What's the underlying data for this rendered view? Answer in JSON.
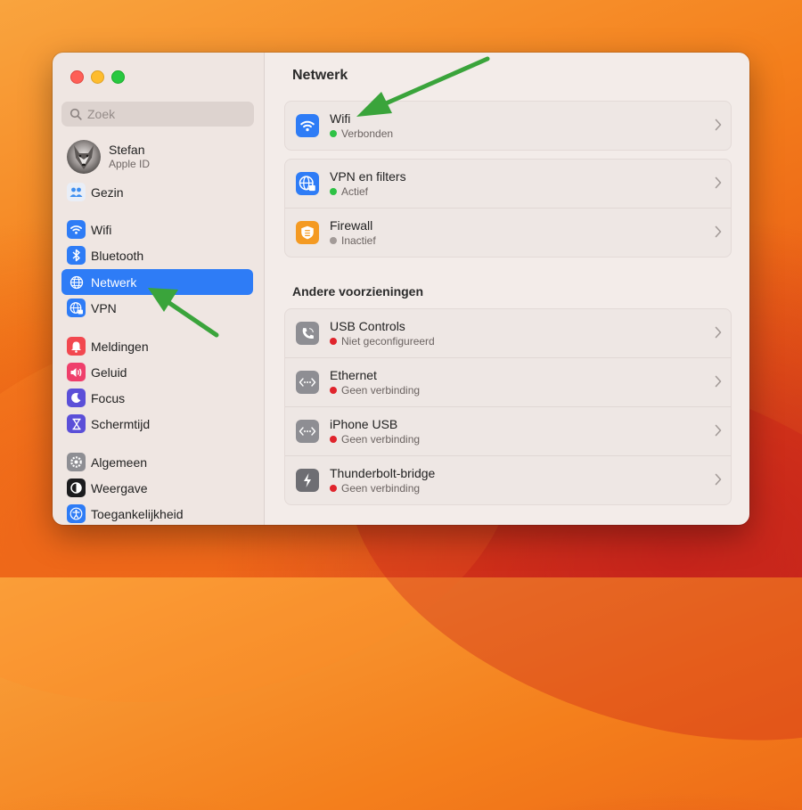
{
  "colors": {
    "accent": "#2e7cf6",
    "status_green": "#2ec245",
    "status_gray": "#a39b98",
    "status_red": "#e0242c",
    "annotation_arrow": "#3aa43b"
  },
  "sidebar": {
    "search": {
      "placeholder": "Zoek"
    },
    "profile": {
      "name": "Stefan",
      "subtitle": "Apple ID"
    },
    "items": [
      {
        "label": "Gezin",
        "icon": "family-icon"
      },
      {
        "label": "Wifi",
        "icon": "wifi-icon"
      },
      {
        "label": "Bluetooth",
        "icon": "bluetooth-icon"
      },
      {
        "label": "Netwerk",
        "icon": "globe-icon",
        "selected": true
      },
      {
        "label": "VPN",
        "icon": "vpn-globe-icon"
      },
      {
        "label": "Meldingen",
        "icon": "bell-icon"
      },
      {
        "label": "Geluid",
        "icon": "speaker-icon"
      },
      {
        "label": "Focus",
        "icon": "moon-icon"
      },
      {
        "label": "Schermtijd",
        "icon": "hourglass-icon"
      },
      {
        "label": "Algemeen",
        "icon": "gear-icon"
      },
      {
        "label": "Weergave",
        "icon": "contrast-icon"
      },
      {
        "label": "Toegankelijkheid",
        "icon": "accessibility-icon"
      }
    ]
  },
  "main": {
    "title": "Netwerk",
    "primary_rows": [
      {
        "title": "Wifi",
        "status": "Verbonden",
        "status_color": "green",
        "icon": "wifi-icon"
      },
      {
        "title": "VPN en filters",
        "status": "Actief",
        "status_color": "green",
        "icon": "vpn-globe-icon"
      },
      {
        "title": "Firewall",
        "status": "Inactief",
        "status_color": "gray",
        "icon": "firewall-shield-icon"
      }
    ],
    "other_section_title": "Andere voorzieningen",
    "other_rows": [
      {
        "title": "USB Controls",
        "status": "Niet geconfigureerd",
        "status_color": "red",
        "icon": "phone-icon"
      },
      {
        "title": "Ethernet",
        "status": "Geen verbinding",
        "status_color": "red",
        "icon": "ethernet-icon"
      },
      {
        "title": "iPhone USB",
        "status": "Geen verbinding",
        "status_color": "red",
        "icon": "ethernet-icon"
      },
      {
        "title": "Thunderbolt-bridge",
        "status": "Geen verbinding",
        "status_color": "red",
        "icon": "thunderbolt-icon"
      }
    ]
  }
}
